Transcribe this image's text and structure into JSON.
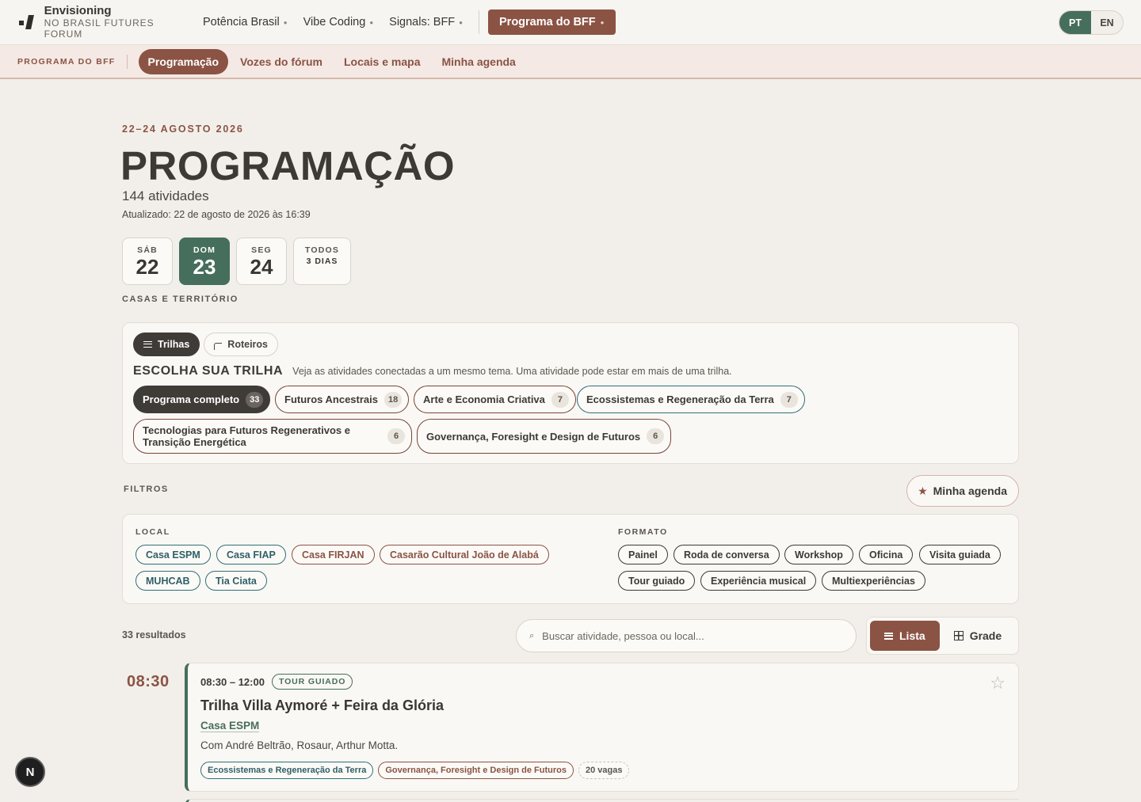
{
  "topbar": {
    "logo_line1": "Envisioning",
    "logo_line2": "NO BRASIL FUTURES FORUM",
    "nav": [
      {
        "label": "Potência Brasil"
      },
      {
        "label": "Vibe Coding"
      },
      {
        "label": "Signals: BFF"
      }
    ],
    "primary_label": "Programa do BFF",
    "lang": {
      "pt": "PT",
      "en": "EN",
      "active": "PT"
    }
  },
  "subnav": {
    "brand": "PROGRAMA DO BFF",
    "tabs": [
      "Programação",
      "Vozes do fórum",
      "Locais e mapa",
      "Minha agenda"
    ],
    "active": "Programação"
  },
  "header": {
    "dates": "22–24 AGOSTO 2026",
    "title": "PROGRAMAÇÃO",
    "count": "144 atividades",
    "updated": "Atualizado: 22 de agosto de 2026 às 16:39"
  },
  "days": [
    {
      "name": "SÁB",
      "num": "22"
    },
    {
      "name": "DOM",
      "num": "23",
      "active": true
    },
    {
      "name": "SEG",
      "num": "24"
    },
    {
      "name": "TODOS",
      "num": "3 DIAS"
    }
  ],
  "casas_label": "CASAS E TERRITÓRIO",
  "trails": {
    "toggles": [
      "Trilhas",
      "Roteiros"
    ],
    "heading": "ESCOLHA SUA TRILHA",
    "description": "Veja as atividades conectadas a um mesmo tema. Uma atividade pode estar em mais de uma trilha.",
    "chips": [
      {
        "label": "Programa completo",
        "count": "33"
      },
      {
        "label": "Futuros Ancestrais",
        "count": "18"
      },
      {
        "label": "Arte e Economia Criativa",
        "count": "7"
      },
      {
        "label": "Ecossistemas e Regeneração da Terra",
        "count": "7"
      },
      {
        "label": "Tecnologias para Futuros Regenerativos e Transição Energética",
        "count": "6"
      },
      {
        "label": "Governança, Foresight e Design de Futuros",
        "count": "6"
      }
    ]
  },
  "filters": {
    "label": "FILTROS",
    "agenda_button": "Minha agenda",
    "local_label": "LOCAL",
    "locals": [
      "Casa ESPM",
      "Casa FIAP",
      "Casa FIRJAN",
      "Casarão Cultural João de Alabá",
      "MUHCAB",
      "Tia Ciata"
    ],
    "format_label": "FORMATO",
    "formats": [
      "Painel",
      "Roda de conversa",
      "Workshop",
      "Oficina",
      "Visita guiada",
      "Tour guiado",
      "Experiência musical",
      "Multiexperiências"
    ]
  },
  "results": {
    "count_label": "33 resultados",
    "search_placeholder": "Buscar atividade, pessoa ou local...",
    "view_list": "Lista",
    "view_grid": "Grade"
  },
  "events": [
    {
      "time_slot": "08:30",
      "time_range": "08:30 – 12:00",
      "format": "TOUR GUIADO",
      "title": "Trilha Villa Aymoré + Feira da Glória",
      "location": "Casa ESPM",
      "people": "Com André Beltrão, Rosaur, Arthur Motta.",
      "tags": [
        "Ecossistemas e Regeneração da Terra",
        "Governança, Foresight e Design de Futuros",
        "20 vagas"
      ]
    }
  ],
  "dev_badge": "N",
  "colors": {
    "brand": "#8b5344",
    "green": "#466e5c",
    "teal": "#2f6f78",
    "bg": "#f2efea"
  },
  "icons": [
    "logo-mark-icon",
    "lines-icon",
    "route-icon",
    "star-icon",
    "search-icon",
    "list-icon",
    "grid-icon",
    "favorite-star-icon"
  ]
}
